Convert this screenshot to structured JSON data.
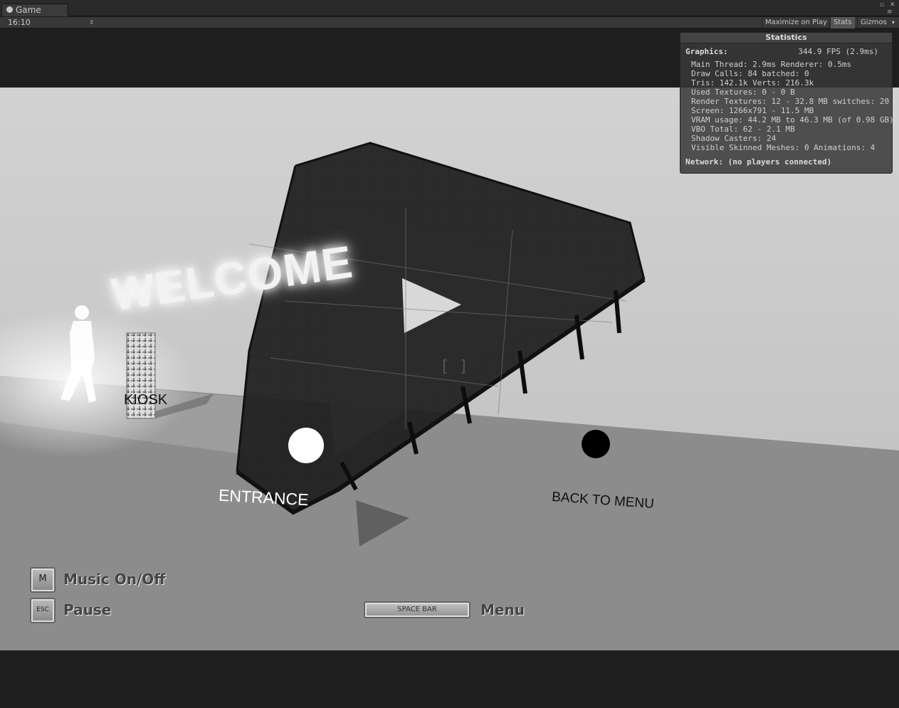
{
  "window": {
    "tab_label": "Game"
  },
  "toolbar": {
    "aspect": "16:10",
    "maximize_on_play": "Maximize on Play",
    "stats": "Stats",
    "gizmos": "Gizmos"
  },
  "scene": {
    "welcome_text": "WELCOME",
    "kiosk_label": "KIOSK",
    "entrance_label": "ENTRANCE",
    "back_label": "BACK TO MENU",
    "crosshair": "[ ]"
  },
  "hud": {
    "music_key": "M",
    "music_label": "Music On/Off",
    "pause_key": "ESC",
    "pause_label": "Pause",
    "menu_key": "SPACE BAR",
    "menu_label": "Menu"
  },
  "stats": {
    "title": "Statistics",
    "graphics_label": "Graphics:",
    "fps": "344.9 FPS (2.9ms)",
    "lines": [
      "Main Thread: 2.9ms  Renderer: 0.5ms",
      "Draw Calls: 84     batched: 0",
      "Tris: 142.1k      Verts: 216.3k",
      "Used Textures: 0 - 0 B",
      "Render Textures: 12 - 32.8 MB  switches: 20",
      "Screen: 1266x791 - 11.5 MB",
      "VRAM usage: 44.2 MB to 46.3 MB (of 0.98 GB)",
      "VBO Total: 62 - 2.1 MB",
      "Shadow Casters: 24",
      "Visible Skinned Meshes: 0     Animations: 4"
    ],
    "network": "Network: (no players connected)"
  },
  "colors": {
    "editor_bg": "#1e1e1e",
    "scene_bg": "#c9c9c9",
    "floor": "#8a8a8a"
  }
}
